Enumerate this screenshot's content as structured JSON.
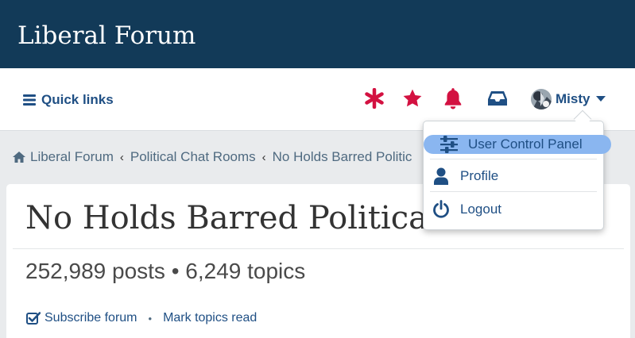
{
  "header": {
    "site_title": "Liberal Forum"
  },
  "navbar": {
    "quick_links": "Quick links",
    "icons": [
      "asterisk-icon",
      "star-icon",
      "bell-icon",
      "inbox-icon"
    ],
    "username": "Misty"
  },
  "breadcrumbs": [
    "Liberal Forum",
    "Political Chat Rooms",
    "No Holds Barred Politic"
  ],
  "forum": {
    "title": "No Holds Barred Political F",
    "stats": "252,989 posts • 6,249 topics",
    "subscribe": "Subscribe forum",
    "mark_read": "Mark topics read"
  },
  "dropdown": {
    "items": [
      {
        "label": "User Control Panel",
        "icon": "sliders-icon"
      },
      {
        "label": "Profile",
        "icon": "user-icon"
      },
      {
        "label": "Logout",
        "icon": "power-icon"
      }
    ]
  },
  "colors": {
    "header_bg": "#123a58",
    "link": "#1f4f84",
    "accent_red": "#d31141",
    "highlight": "#8ab6f0"
  }
}
